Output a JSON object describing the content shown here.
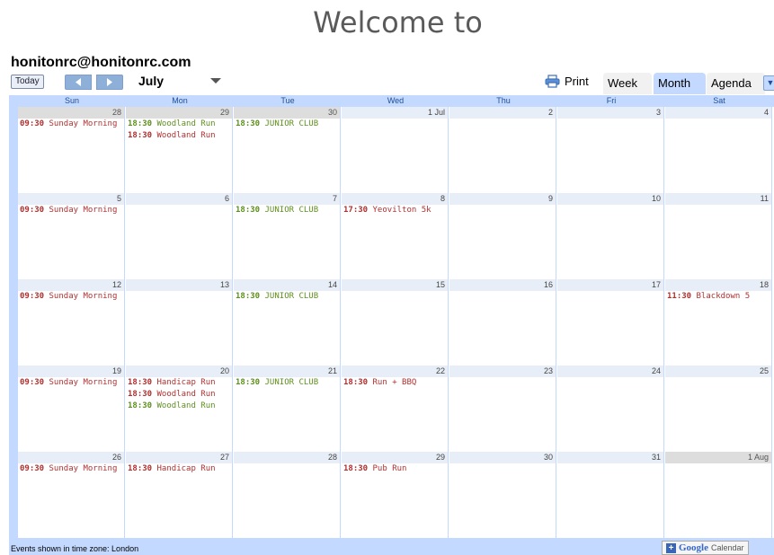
{
  "page": {
    "heading": "Welcome to"
  },
  "calendar": {
    "title": "honitonrc@honitonrc.com",
    "today_label": "Today",
    "month_label": "July",
    "print_label": "Print",
    "tabs": [
      "Week",
      "Month",
      "Agenda"
    ],
    "active_tab": "Month",
    "weekdays": [
      "Sun",
      "Mon",
      "Tue",
      "Wed",
      "Thu",
      "Fri",
      "Sat"
    ],
    "weeks": [
      [
        {
          "date": "28",
          "other": true,
          "events": [
            {
              "time": "09:30",
              "title": "Sunday Morning",
              "color": "#b03030"
            }
          ]
        },
        {
          "date": "29",
          "other": true,
          "events": [
            {
              "time": "18:30",
              "title": "Woodland Run",
              "color": "#5e8f20"
            },
            {
              "time": "18:30",
              "title": "Woodland Run",
              "color": "#b03030"
            }
          ]
        },
        {
          "date": "30",
          "other": true,
          "events": [
            {
              "time": "18:30",
              "title": "JUNIOR CLUB",
              "color": "#5e8f20"
            }
          ]
        },
        {
          "date": "1 Jul",
          "other": false,
          "events": []
        },
        {
          "date": "2",
          "other": false,
          "events": []
        },
        {
          "date": "3",
          "other": false,
          "events": []
        },
        {
          "date": "4",
          "other": false,
          "events": []
        }
      ],
      [
        {
          "date": "5",
          "other": false,
          "events": [
            {
              "time": "09:30",
              "title": "Sunday Morning",
              "color": "#b03030"
            }
          ]
        },
        {
          "date": "6",
          "other": false,
          "events": []
        },
        {
          "date": "7",
          "other": false,
          "events": [
            {
              "time": "18:30",
              "title": "JUNIOR CLUB",
              "color": "#5e8f20"
            }
          ]
        },
        {
          "date": "8",
          "other": false,
          "events": [
            {
              "time": "17:30",
              "title": "Yeovilton 5k",
              "color": "#b03030"
            }
          ]
        },
        {
          "date": "9",
          "other": false,
          "events": []
        },
        {
          "date": "10",
          "other": false,
          "events": []
        },
        {
          "date": "11",
          "other": false,
          "events": []
        }
      ],
      [
        {
          "date": "12",
          "other": false,
          "events": [
            {
              "time": "09:30",
              "title": "Sunday Morning",
              "color": "#b03030"
            }
          ]
        },
        {
          "date": "13",
          "other": false,
          "events": []
        },
        {
          "date": "14",
          "other": false,
          "events": [
            {
              "time": "18:30",
              "title": "JUNIOR CLUB",
              "color": "#5e8f20"
            }
          ]
        },
        {
          "date": "15",
          "other": false,
          "events": []
        },
        {
          "date": "16",
          "other": false,
          "events": []
        },
        {
          "date": "17",
          "other": false,
          "events": []
        },
        {
          "date": "18",
          "other": false,
          "events": [
            {
              "time": "11:30",
              "title": "Blackdown 5",
              "color": "#b03030"
            }
          ]
        }
      ],
      [
        {
          "date": "19",
          "other": false,
          "events": [
            {
              "time": "09:30",
              "title": "Sunday Morning",
              "color": "#b03030"
            }
          ]
        },
        {
          "date": "20",
          "other": false,
          "events": [
            {
              "time": "18:30",
              "title": "Handicap Run",
              "color": "#b03030"
            },
            {
              "time": "18:30",
              "title": "Woodland Run",
              "color": "#b03030"
            },
            {
              "time": "18:30",
              "title": "Woodland Run",
              "color": "#5e8f20"
            }
          ]
        },
        {
          "date": "21",
          "other": false,
          "events": [
            {
              "time": "18:30",
              "title": "JUNIOR CLUB",
              "color": "#5e8f20"
            }
          ]
        },
        {
          "date": "22",
          "other": false,
          "events": [
            {
              "time": "18:30",
              "title": "Run + BBQ",
              "color": "#b03030"
            }
          ]
        },
        {
          "date": "23",
          "other": false,
          "events": []
        },
        {
          "date": "24",
          "other": false,
          "events": []
        },
        {
          "date": "25",
          "other": false,
          "events": []
        }
      ],
      [
        {
          "date": "26",
          "other": false,
          "events": [
            {
              "time": "09:30",
              "title": "Sunday Morning",
              "color": "#b03030"
            }
          ]
        },
        {
          "date": "27",
          "other": false,
          "events": [
            {
              "time": "18:30",
              "title": "Handicap Run",
              "color": "#b03030"
            }
          ]
        },
        {
          "date": "28",
          "other": false,
          "events": []
        },
        {
          "date": "29",
          "other": false,
          "events": [
            {
              "time": "18:30",
              "title": "Pub Run",
              "color": "#b03030"
            }
          ]
        },
        {
          "date": "30",
          "other": false,
          "events": []
        },
        {
          "date": "31",
          "other": false,
          "events": []
        },
        {
          "date": "1 Aug",
          "other": true,
          "events": []
        }
      ]
    ],
    "footer": {
      "timezone_text": "Events shown in time zone: London",
      "badge_google": "Google",
      "badge_calendar": "Calendar"
    },
    "colors": {
      "accent": "#c3d9ff",
      "day_header": "#e8eef7",
      "red_event": "#b03030",
      "green_event": "#5e8f20"
    }
  }
}
